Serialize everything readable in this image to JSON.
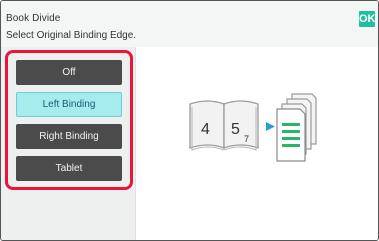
{
  "header": {
    "title": "Book Divide",
    "subtitle": "Select Original Binding Edge.",
    "ok_label": "OK"
  },
  "options": [
    {
      "label": "Off",
      "selected": false
    },
    {
      "label": "Left Binding",
      "selected": true
    },
    {
      "label": "Right Binding",
      "selected": false
    },
    {
      "label": "Tablet",
      "selected": false
    }
  ],
  "illustration": {
    "page_left": "4",
    "page_right": "5",
    "page_sub": "7",
    "icons": [
      "open-book-icon",
      "arrow-right-icon",
      "stacked-pages-icon"
    ]
  },
  "colors": {
    "accent": "#1fc0a0",
    "highlight": "#e8163a",
    "selected_bg": "#a7ecec",
    "button_bg": "#4b4b4b",
    "arrow": "#2a9fd6"
  }
}
